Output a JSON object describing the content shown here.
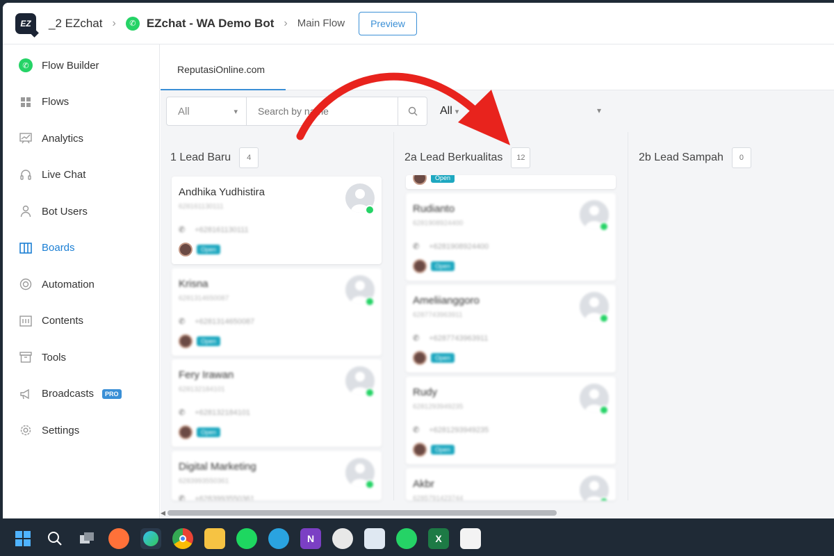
{
  "breadcrumb": {
    "workspace": "_2 EZchat",
    "bot": "EZchat - WA Demo Bot",
    "flow": "Main Flow",
    "preview_label": "Preview"
  },
  "sidebar": {
    "items": [
      {
        "label": "Flow Builder",
        "icon": "whatsapp-icon"
      },
      {
        "label": "Flows",
        "icon": "grid-icon"
      },
      {
        "label": "Analytics",
        "icon": "chart-icon"
      },
      {
        "label": "Live Chat",
        "icon": "headset-icon"
      },
      {
        "label": "Bot Users",
        "icon": "user-icon"
      },
      {
        "label": "Boards",
        "icon": "board-icon",
        "active": true
      },
      {
        "label": "Automation",
        "icon": "lifebuoy-icon"
      },
      {
        "label": "Contents",
        "icon": "contents-icon"
      },
      {
        "label": "Tools",
        "icon": "box-icon"
      },
      {
        "label": "Broadcasts",
        "icon": "megaphone-icon",
        "badge": "PRO"
      },
      {
        "label": "Settings",
        "icon": "gear-icon"
      }
    ]
  },
  "board": {
    "tab": "ReputasiOnline.com",
    "filter_select": "All",
    "search_placeholder": "Search by name",
    "all_filter": "All",
    "columns": [
      {
        "title": "1 Lead Baru",
        "count": "4",
        "cards": [
          {
            "name": "Andhika Yudhistira",
            "id": "628161130111",
            "phone": "+628161130111",
            "status": "Open"
          },
          {
            "name": "Krisna",
            "id": "6281314650087",
            "phone": "+6281314650087",
            "status": "Open"
          },
          {
            "name": "Fery Irawan",
            "id": "628132184101",
            "phone": "+628132184101",
            "status": "Open"
          },
          {
            "name": "Digital Marketing",
            "id": "6283993550361",
            "phone": "+6283993550361",
            "status": ""
          }
        ]
      },
      {
        "title": "2a Lead Berkualitas",
        "count": "12",
        "cards": [
          {
            "name": "Rudianto",
            "id": "6281908924400",
            "phone": "+6281908924400",
            "status": "Open"
          },
          {
            "name": "Ameliianggoro",
            "id": "6287743963911",
            "phone": "+6287743963911",
            "status": "Open"
          },
          {
            "name": "Rudy",
            "id": "6281293949235",
            "phone": "+6281293949235",
            "status": "Open"
          },
          {
            "name": "Akbr",
            "id": "6285791423744",
            "phone": "",
            "status": ""
          }
        ],
        "partial_status": "Open"
      },
      {
        "title": "2b Lead Sampah",
        "count": "0",
        "cards": []
      }
    ]
  },
  "colors": {
    "accent": "#3a8fd6",
    "whatsapp": "#25d366",
    "status": "#1ea8c0",
    "annotation": "#e8231d"
  },
  "taskbar": {
    "icons": [
      "windows-start-icon",
      "search-icon",
      "task-view-icon",
      "firefox-icon",
      "edge-icon",
      "chrome-icon",
      "file-explorer-icon",
      "spotify-icon",
      "telegram-icon",
      "onenote-icon",
      "clock-icon",
      "mail-icon",
      "whatsapp-icon",
      "excel-icon",
      "snip-icon"
    ]
  }
}
